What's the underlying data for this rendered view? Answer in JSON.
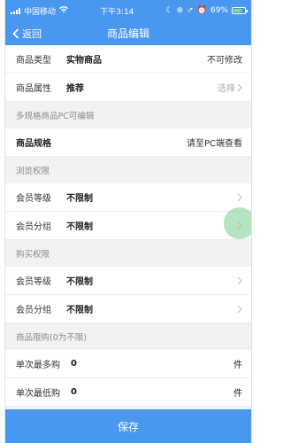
{
  "status": {
    "carrier": "中国移动",
    "time": "下午3:14",
    "battery": "69%"
  },
  "nav": {
    "back_label": "返回",
    "title": "商品编辑"
  },
  "rows": {
    "type": {
      "label": "商品类型",
      "value": "实物商品",
      "right": "不可修改"
    },
    "attr": {
      "label": "商品属性",
      "value": "推荐",
      "right": "选择"
    },
    "spec_section": "多规格商品PC可编辑",
    "spec": {
      "label": "商品规格",
      "right": "请至PC端查看"
    },
    "browse_section": "浏览权限",
    "browse_level": {
      "label": "会员等级",
      "value": "不限制"
    },
    "browse_group": {
      "label": "会员分组",
      "value": "不限制"
    },
    "buy_section": "购买权限",
    "buy_level": {
      "label": "会员等级",
      "value": "不限制"
    },
    "buy_group": {
      "label": "会员分组",
      "value": "不限制"
    },
    "limit_section": "商品限购(0为不限)",
    "max_buy": {
      "label": "单次最多购",
      "value": "0",
      "unit": "件"
    },
    "min_buy": {
      "label": "单次最低购",
      "value": "0",
      "unit": "件"
    }
  },
  "save_label": "保存",
  "colors": {
    "accent": "#4a97f0",
    "touch_indicator": "#78cd8c"
  }
}
